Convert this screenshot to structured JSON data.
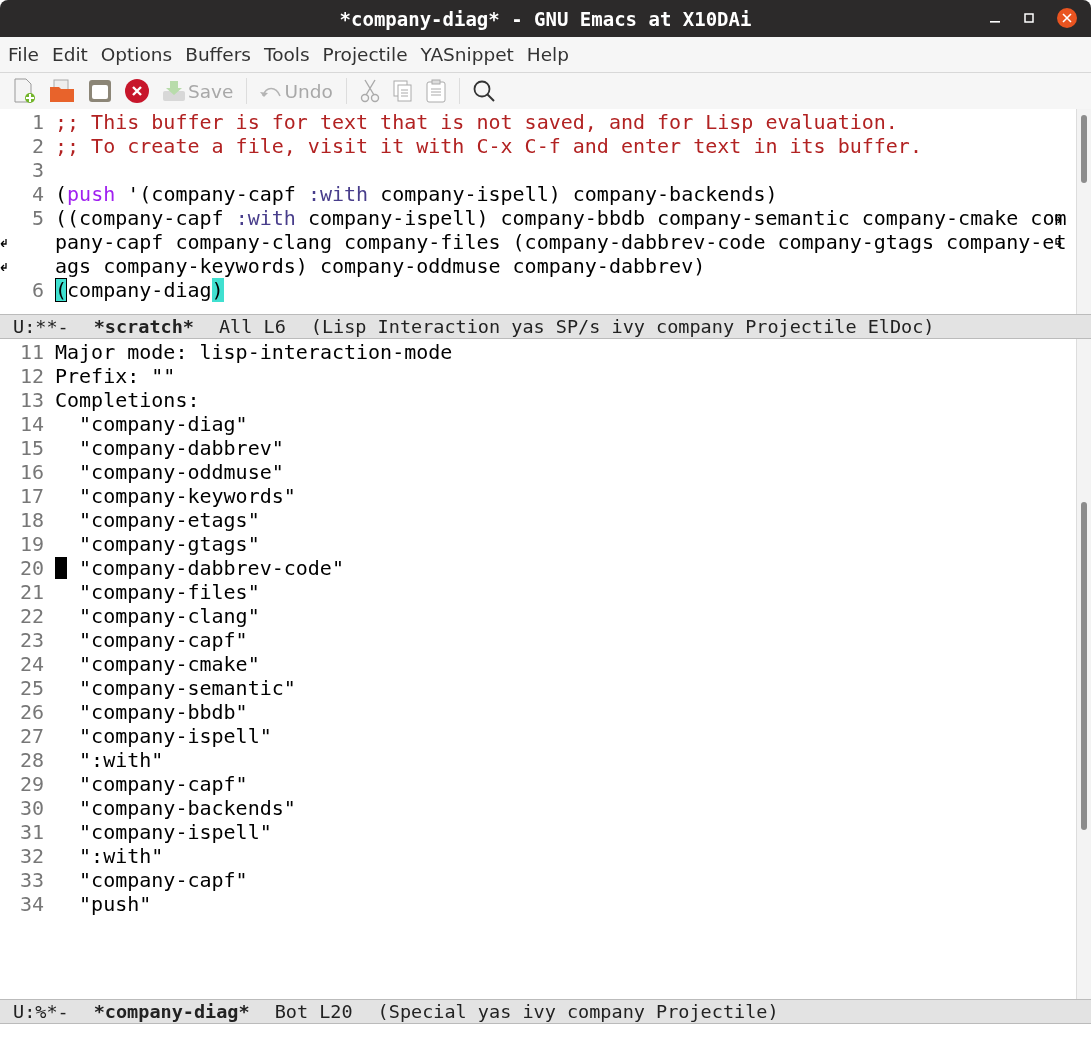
{
  "window": {
    "title": "*company-diag* - GNU Emacs at X10DAi"
  },
  "menu": [
    "File",
    "Edit",
    "Options",
    "Buffers",
    "Tools",
    "Projectile",
    "YASnippet",
    "Help"
  ],
  "toolbar": {
    "save": {
      "label": "Save",
      "disabled": true
    },
    "undo": {
      "label": "Undo",
      "disabled": true
    }
  },
  "upper_buffer": {
    "rows": [
      {
        "number": "1",
        "continued": false,
        "segments": [
          {
            "kind": "comment",
            "text": ";; This buffer is for text that is not saved, and for Lisp evaluation."
          }
        ]
      },
      {
        "number": "2",
        "continued": false,
        "segments": [
          {
            "kind": "comment",
            "text": ";; To create a file, visit it with C-x C-f and enter text in its buffer."
          }
        ]
      },
      {
        "number": "3",
        "continued": false,
        "segments": []
      },
      {
        "number": "4",
        "continued": false,
        "segments": [
          {
            "kind": "plain",
            "text": "("
          },
          {
            "kind": "keyword",
            "text": "push"
          },
          {
            "kind": "plain",
            "text": " '(company-capf "
          },
          {
            "kind": "constant",
            "text": ":with"
          },
          {
            "kind": "plain",
            "text": " company-ispell) company-backends)"
          }
        ]
      },
      {
        "number": "5",
        "continued": true,
        "segments": [
          {
            "kind": "plain",
            "text": "((company-capf "
          },
          {
            "kind": "constant",
            "text": ":with"
          },
          {
            "kind": "plain",
            "text": " company-ispell) company-bbdb company-semantic company-cmake com"
          }
        ]
      },
      {
        "continued": true,
        "segments": [
          {
            "kind": "plain",
            "text": "pany-capf company-clang company-files (company-dabbrev-code company-gtags company-et"
          }
        ]
      },
      {
        "continued": false,
        "segments": [
          {
            "kind": "plain",
            "text": "ags company-keywords) company-oddmuse company-dabbrev)"
          }
        ]
      },
      {
        "number": "6",
        "continued": false,
        "segments": [
          {
            "kind": "cursor-match",
            "text": "("
          },
          {
            "kind": "plain",
            "text": "company-diag"
          },
          {
            "kind": "match",
            "text": ")"
          }
        ]
      }
    ]
  },
  "upper_mode_line": {
    "state": "U:**-",
    "buffer": "*scratch*",
    "position": "All L6",
    "modes": "(Lisp Interaction yas SP/s ivy company Projectile ElDoc)"
  },
  "lower_buffer": {
    "rows": [
      {
        "number": "11",
        "cursor": false,
        "text": "Major mode: lisp-interaction-mode"
      },
      {
        "number": "12",
        "cursor": false,
        "text": "Prefix: \"\""
      },
      {
        "number": "13",
        "cursor": false,
        "text": "Completions:"
      },
      {
        "number": "14",
        "cursor": false,
        "text": "  \"company-diag\""
      },
      {
        "number": "15",
        "cursor": false,
        "text": "  \"company-dabbrev\""
      },
      {
        "number": "16",
        "cursor": false,
        "text": "  \"company-oddmuse\""
      },
      {
        "number": "17",
        "cursor": false,
        "text": "  \"company-keywords\""
      },
      {
        "number": "18",
        "cursor": false,
        "text": "  \"company-etags\""
      },
      {
        "number": "19",
        "cursor": false,
        "text": "  \"company-gtags\""
      },
      {
        "number": "20",
        "cursor": true,
        "text": "  \"company-dabbrev-code\""
      },
      {
        "number": "21",
        "cursor": false,
        "text": "  \"company-files\""
      },
      {
        "number": "22",
        "cursor": false,
        "text": "  \"company-clang\""
      },
      {
        "number": "23",
        "cursor": false,
        "text": "  \"company-capf\""
      },
      {
        "number": "24",
        "cursor": false,
        "text": "  \"company-cmake\""
      },
      {
        "number": "25",
        "cursor": false,
        "text": "  \"company-semantic\""
      },
      {
        "number": "26",
        "cursor": false,
        "text": "  \"company-bbdb\""
      },
      {
        "number": "27",
        "cursor": false,
        "text": "  \"company-ispell\""
      },
      {
        "number": "28",
        "cursor": false,
        "text": "  \":with\""
      },
      {
        "number": "29",
        "cursor": false,
        "text": "  \"company-capf\""
      },
      {
        "number": "30",
        "cursor": false,
        "text": "  \"company-backends\""
      },
      {
        "number": "31",
        "cursor": false,
        "text": "  \"company-ispell\""
      },
      {
        "number": "32",
        "cursor": false,
        "text": "  \":with\""
      },
      {
        "number": "33",
        "cursor": false,
        "text": "  \"company-capf\""
      },
      {
        "number": "34",
        "cursor": false,
        "text": "  \"push\""
      }
    ]
  },
  "lower_mode_line": {
    "state": "U:%*-",
    "buffer": "*company-diag*",
    "position": "Bot L20",
    "modes": "(Special yas ivy company Projectile)"
  }
}
